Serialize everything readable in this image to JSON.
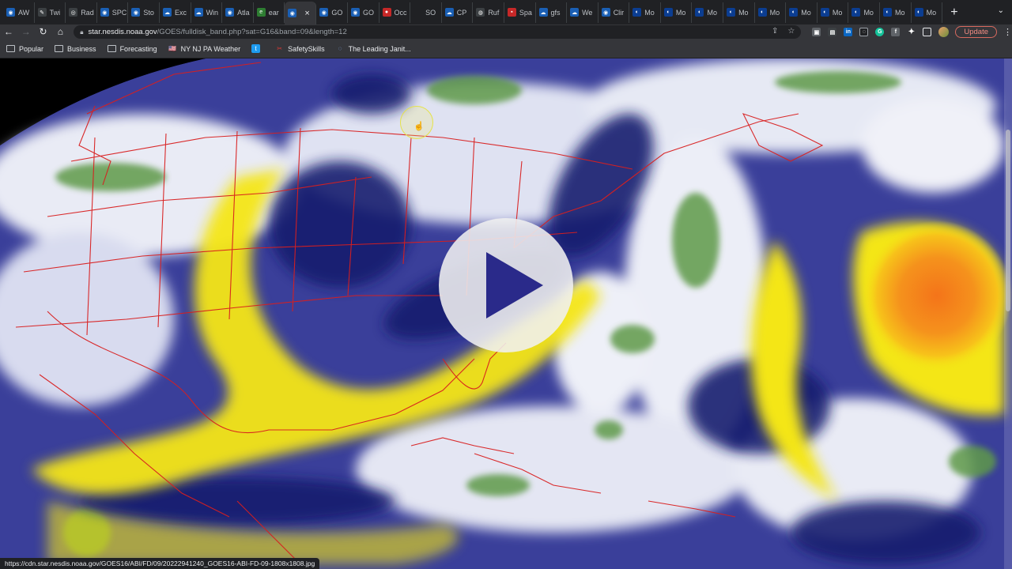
{
  "tabs": [
    {
      "label": "AW",
      "icon": "noaa-icon",
      "color": "#1a5fb4"
    },
    {
      "label": "Twi",
      "icon": "feather-icon",
      "color": "#3c4043"
    },
    {
      "label": "Rad",
      "icon": "radar-icon",
      "color": "#3c4043"
    },
    {
      "label": "SPC",
      "icon": "noaa-icon",
      "color": "#1a5fb4"
    },
    {
      "label": "Sto",
      "icon": "noaa-icon",
      "color": "#1a5fb4"
    },
    {
      "label": "Exc",
      "icon": "weather-icon",
      "color": "#1a5fb4"
    },
    {
      "label": "Win",
      "icon": "weather-icon",
      "color": "#1a5fb4"
    },
    {
      "label": "Atla",
      "icon": "noaa-icon",
      "color": "#1a5fb4"
    },
    {
      "label": "ear",
      "icon": "earth-icon",
      "color": "#2e7d32"
    },
    {
      "label": "",
      "icon": "noaa-icon",
      "color": "#1a5fb4",
      "active": true
    },
    {
      "label": "GO",
      "icon": "noaa-icon",
      "color": "#1a5fb4"
    },
    {
      "label": "GO",
      "icon": "noaa-icon",
      "color": "#1a5fb4"
    },
    {
      "label": "Occ",
      "icon": "drop-icon",
      "color": "#c62828"
    },
    {
      "label": "SO",
      "icon": "blank-icon",
      "color": "#202124"
    },
    {
      "label": "CP",
      "icon": "weather-icon",
      "color": "#1a5fb4"
    },
    {
      "label": "Ruf",
      "icon": "globe-icon",
      "color": "#3c4043"
    },
    {
      "label": "Spa",
      "icon": "flag-icon",
      "color": "#c62828"
    },
    {
      "label": "gfs",
      "icon": "weather-icon",
      "color": "#1a5fb4"
    },
    {
      "label": "We",
      "icon": "weather-icon",
      "color": "#1a5fb4"
    },
    {
      "label": "Clir",
      "icon": "noaa-icon",
      "color": "#1a5fb4"
    },
    {
      "label": "Mo",
      "icon": "moon-icon",
      "color": "#0b3d91"
    },
    {
      "label": "Mo",
      "icon": "moon-icon",
      "color": "#0b3d91"
    },
    {
      "label": "Mo",
      "icon": "moon-icon",
      "color": "#0b3d91"
    },
    {
      "label": "Mo",
      "icon": "moon-icon",
      "color": "#0b3d91"
    },
    {
      "label": "Mo",
      "icon": "moon-icon",
      "color": "#0b3d91"
    },
    {
      "label": "Mo",
      "icon": "moon-icon",
      "color": "#0b3d91"
    },
    {
      "label": "Mo",
      "icon": "moon-icon",
      "color": "#0b3d91"
    },
    {
      "label": "Mo",
      "icon": "moon-icon",
      "color": "#0b3d91"
    },
    {
      "label": "Mo",
      "icon": "moon-icon",
      "color": "#0b3d91"
    },
    {
      "label": "Mo",
      "icon": "moon-icon",
      "color": "#0b3d91"
    }
  ],
  "toolbar": {
    "url_host": "star.nesdis.noaa.gov",
    "url_path": "/GOES/fulldisk_band.php?sat=G16&band=09&length=12",
    "update_label": "Update"
  },
  "bookmarks": [
    {
      "label": "Popular",
      "icon": "folder-icon"
    },
    {
      "label": "Business",
      "icon": "folder-icon"
    },
    {
      "label": "Forecasting",
      "icon": "folder-icon"
    },
    {
      "label": "NY NJ PA Weather",
      "icon": "weather-flag-icon"
    },
    {
      "label": "",
      "icon": "twitter-icon"
    },
    {
      "label": "SafetySkills",
      "icon": "safety-icon"
    },
    {
      "label": "The Leading Janit...",
      "icon": "loading-icon"
    }
  ],
  "status_url": "https://cdn.star.nesdis.noaa.gov/GOES16/ABI/FD/09/20222941240_GOES16-ABI-FD-09-1808x1808.jpg",
  "colors": {
    "moist_white": "#f2f2fa",
    "mid_blue": "#3a3f9a",
    "dry_navy": "#141a6e",
    "dry_yellow": "#f4e618",
    "very_dry_orange": "#f5921c",
    "cold_green": "#5e9a4a",
    "borders_red": "#d81f1f"
  }
}
